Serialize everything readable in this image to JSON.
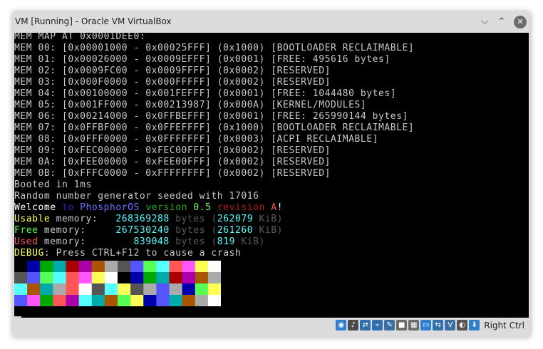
{
  "window": {
    "title": "VM [Running] - Oracle VM VirtualBox",
    "controls": {
      "minimize": "⌵",
      "maximize": "⌃",
      "close": "✕"
    }
  },
  "console": {
    "lines": [
      [
        {
          "t": "MEM MAP AT 0x0001DEE0:",
          "c": "#c8c8c8"
        }
      ],
      [
        {
          "t": "MEM 00: [0x00001000 - 0x00025FFF] (0x1000) [BOOTLOADER RECLAIMABLE]",
          "c": "#c8c8c8"
        }
      ],
      [
        {
          "t": "MEM 01: [0x00026000 - 0x0009EFFF] (0x0001) [FREE: 495616 bytes]",
          "c": "#c8c8c8"
        }
      ],
      [
        {
          "t": "MEM 02: [0x0009FC00 - 0x0009FFFF] (0x0002) [RESERVED]",
          "c": "#c8c8c8"
        }
      ],
      [
        {
          "t": "MEM 03: [0x000F0000 - 0x000FFFFF] (0x0002) [RESERVED]",
          "c": "#c8c8c8"
        }
      ],
      [
        {
          "t": "MEM 04: [0x00100000 - 0x001FEFFF] (0x0001) [FREE: 1044480 bytes]",
          "c": "#c8c8c8"
        }
      ],
      [
        {
          "t": "MEM 05: [0x001FF000 - 0x00213987] (0x000A) [KERNEL/MODULES]",
          "c": "#c8c8c8"
        }
      ],
      [
        {
          "t": "MEM 06: [0x00214000 - 0x0FFBEFFF] (0x0001) [FREE: 265990144 bytes]",
          "c": "#c8c8c8"
        }
      ],
      [
        {
          "t": "MEM 07: [0x0FFBF000 - 0x0FFEFFFF] (0x1000) [BOOTLOADER RECLAIMABLE]",
          "c": "#c8c8c8"
        }
      ],
      [
        {
          "t": "MEM 08: [0x0FFF0000 - 0x0FFFFFFF] (0x0003) [ACPI RECLAIMABLE]",
          "c": "#c8c8c8"
        }
      ],
      [
        {
          "t": "MEM 09: [0xFEC00000 - 0xFEC00FFF] (0x0002) [RESERVED]",
          "c": "#c8c8c8"
        }
      ],
      [
        {
          "t": "MEM 0A: [0xFEE00000 - 0xFEE00FFF] (0x0002) [RESERVED]",
          "c": "#c8c8c8"
        }
      ],
      [
        {
          "t": "MEM 0B: [0xFFFC0000 - 0xFFFFFFFF] (0x0002) [RESERVED]",
          "c": "#c8c8c8"
        }
      ],
      [
        {
          "t": "Booted in 1ms",
          "c": "#c8c8c8"
        }
      ],
      [
        {
          "t": "Random number generator seeded with 17016",
          "c": "#c8c8c8"
        }
      ],
      [
        {
          "t": "Welcome ",
          "c": "#ffffff"
        },
        {
          "t": "to ",
          "c": "#2222c0"
        },
        {
          "t": "PhosphorOS ",
          "c": "#6e6eff"
        },
        {
          "t": "version ",
          "c": "#22a822"
        },
        {
          "t": "0.5 ",
          "c": "#66ff66"
        },
        {
          "t": "revision ",
          "c": "#b01c1c"
        },
        {
          "t": "A",
          "c": "#ff5050"
        },
        {
          "t": "!",
          "c": "#ffffff"
        }
      ],
      [
        {
          "t": "Usable",
          "c": "#ffff55"
        },
        {
          "t": " memory:   ",
          "c": "#c8c8c8"
        },
        {
          "t": "268369288",
          "c": "#55ffff"
        },
        {
          "t": " bytes (",
          "c": "#5a5a5a"
        },
        {
          "t": "262079",
          "c": "#55ffff"
        },
        {
          "t": " KiB)",
          "c": "#5a5a5a"
        }
      ],
      [
        {
          "t": "Free",
          "c": "#55ff55"
        },
        {
          "t": " memory:     ",
          "c": "#c8c8c8"
        },
        {
          "t": "267530240",
          "c": "#55ffff"
        },
        {
          "t": " bytes (",
          "c": "#5a5a5a"
        },
        {
          "t": "261260",
          "c": "#55ffff"
        },
        {
          "t": " KiB)",
          "c": "#5a5a5a"
        }
      ],
      [
        {
          "t": "Used",
          "c": "#ff5555"
        },
        {
          "t": " memory:        ",
          "c": "#c8c8c8"
        },
        {
          "t": "839048",
          "c": "#55ffff"
        },
        {
          "t": " bytes (",
          "c": "#5a5a5a"
        },
        {
          "t": "819",
          "c": "#55ffff"
        },
        {
          "t": " KiB)",
          "c": "#5a5a5a"
        }
      ],
      [
        {
          "t": "DEBUG",
          "c": "#ffff55"
        },
        {
          "t": ": Press CTRL+F12 to cause a crash",
          "c": "#c8c8c8"
        }
      ]
    ]
  },
  "palette": {
    "rows": [
      [
        "#000000",
        "#0000aa",
        "#00aa00",
        "#00aaaa",
        "#aa0000",
        "#aa00aa",
        "#aa5500",
        "#aaaaaa",
        "#555555",
        "#5555ff",
        "#55ff55",
        "#55ffff",
        "#ff5555",
        "#ff55ff",
        "#ffff55",
        "#ffffff"
      ],
      [
        "#555555",
        "#5555ff",
        "#55ff55",
        "#55ffff",
        "#ff5555",
        "#ff55ff",
        "#ffff55",
        "#ffffff",
        "#000000",
        "#0000aa",
        "#00aa00",
        "#00aaaa",
        "#aa0000",
        "#aa00aa",
        "#aa5500",
        "#aaaaaa"
      ],
      [
        "#55ffff",
        "#aa5500",
        "#00aaaa",
        "#aaaaaa",
        "#ff5555",
        "#ffffff",
        "#555555",
        "#55ffff",
        "#ffff55",
        "#555555",
        "#aaaaaa",
        "#5555ff",
        "#aaaaaa",
        "#0000aa",
        "#55ff55",
        "#ffff55"
      ],
      [
        "#5555ff",
        "#ff55ff",
        "#00aa00",
        "#ff5555",
        "#aa00aa",
        "#55ffff",
        "#00aaaa",
        "#aa5500",
        "#55ff55",
        "#ffff55",
        "#0000aa",
        "#5555ff",
        "#00aaaa",
        "#aa5500",
        "#aaaaaa",
        "#ffffff"
      ]
    ]
  },
  "statusbar": {
    "icons": [
      {
        "name": "optical-drive-icon",
        "color": "#2f7fd0",
        "glyph": "◉"
      },
      {
        "name": "audio-icon",
        "color": "#4a4a4a",
        "glyph": "♪"
      },
      {
        "name": "network-icon",
        "color": "#2f6fb0",
        "glyph": "⇄"
      },
      {
        "name": "usb-icon",
        "color": "#2f6fb0",
        "glyph": "⌁"
      },
      {
        "name": "shared-folders-icon",
        "color": "#3a6ea5",
        "glyph": "✎"
      },
      {
        "name": "display-icon",
        "color": "#6a6a6a",
        "glyph": "■"
      },
      {
        "name": "screen-icon",
        "color": "#6a6a6a",
        "glyph": "▦"
      },
      {
        "name": "video-capture-icon",
        "color": "#2f7fd0",
        "glyph": "▭"
      },
      {
        "name": "virtualization-icon",
        "color": "#2f6fb0",
        "glyph": "⇆"
      },
      {
        "name": "cpu-icon",
        "color": "#3a6ea5",
        "glyph": "V"
      },
      {
        "name": "mouse-integration-icon",
        "color": "#555555",
        "glyph": "◐"
      },
      {
        "name": "keyboard-capture-icon",
        "color": "#2f7fd0",
        "glyph": "⬇"
      }
    ],
    "host_key": "Right Ctrl"
  }
}
